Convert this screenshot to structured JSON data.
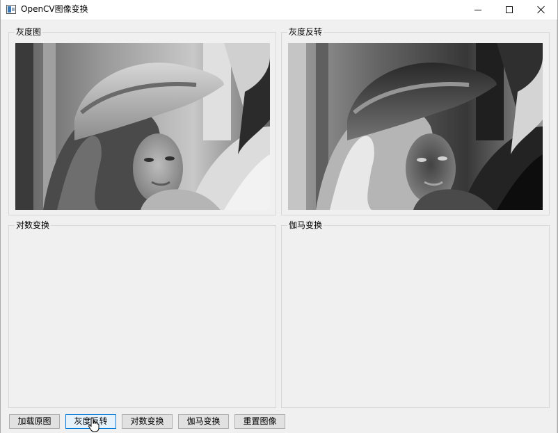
{
  "window": {
    "title": "OpenCV图像变换",
    "icon": "app-window-icon",
    "controls": [
      "minimize-icon",
      "maximize-icon",
      "close-icon"
    ]
  },
  "panels": {
    "grayscale": {
      "title": "灰度图",
      "image": "grayscale-portrait"
    },
    "invert": {
      "title": "灰度反转",
      "image": "inverted-portrait"
    },
    "log": {
      "title": "对数变换"
    },
    "gamma": {
      "title": "伽马变换"
    }
  },
  "buttons": {
    "load": "加载原图",
    "invert": "灰度反转",
    "log": "对数变换",
    "gamma": "伽马变换",
    "reset": "重置图像"
  },
  "colors": {
    "window_bg": "#f0f0f0",
    "focus_border": "#0078d7",
    "button_bg": "#e1e1e1"
  }
}
